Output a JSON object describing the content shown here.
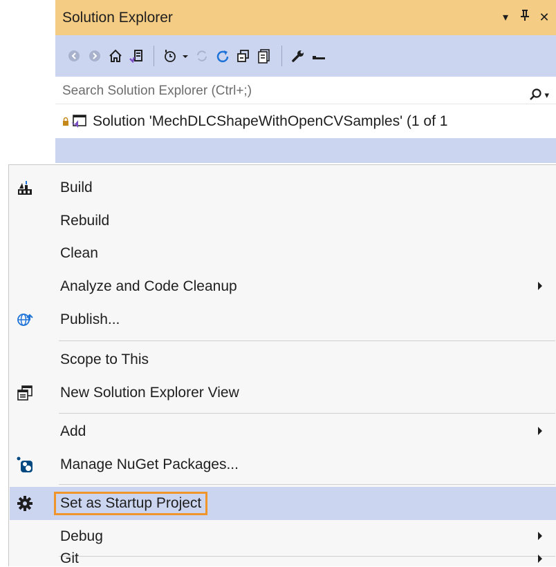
{
  "solution_explorer": {
    "title": "Solution Explorer",
    "title_controls": {
      "dropdown": "▾",
      "pin": "⊥",
      "close": "✕"
    },
    "search_placeholder": "Search Solution Explorer (Ctrl+;)",
    "search_icon_arrow": "▾",
    "tree": {
      "solution_label": "Solution 'MechDLCShapeWithOpenCVSamples' (1 of 1"
    }
  },
  "context_menu": {
    "items": [
      {
        "label": "Build",
        "icon": "build-icon"
      },
      {
        "label": "Rebuild"
      },
      {
        "label": "Clean"
      },
      {
        "label": "Analyze and Code Cleanup",
        "submenu": true
      },
      {
        "label": "Publish...",
        "icon": "globe-publish-icon"
      },
      {
        "label": "Scope to This"
      },
      {
        "label": "New Solution Explorer View",
        "icon": "new-window-icon"
      },
      {
        "label": "Add",
        "submenu": true
      },
      {
        "label": "Manage NuGet Packages...",
        "icon": "nuget-icon"
      },
      {
        "label": "Set as Startup Project",
        "icon": "gear-icon",
        "highlighted": true
      },
      {
        "label": "Debug",
        "submenu": true
      },
      {
        "label": "Git",
        "submenu": true
      }
    ]
  },
  "colors": {
    "title_bar": "#f5cc84",
    "toolbar": "#ccd5f0",
    "highlight": "#ccd5f0",
    "highlight_outline": "#f0952b",
    "menu_bg": "#f7f7f8"
  }
}
